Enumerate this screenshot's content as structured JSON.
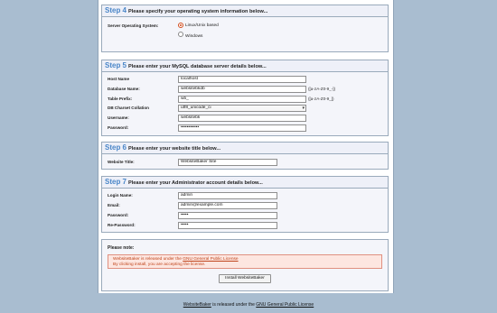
{
  "step4": {
    "number": "Step 4",
    "title": "Please specify your operating system information below...",
    "os_label": "Server Operating System:",
    "options": [
      {
        "label": "Linux/Unix based",
        "selected": true
      },
      {
        "label": "Windows",
        "selected": false
      }
    ]
  },
  "step5": {
    "number": "Step 5",
    "title": "Please enter your MySQL database server details below...",
    "fields": [
      {
        "label": "Host Name",
        "value": "localhost",
        "hint": ""
      },
      {
        "label": "Database Name:",
        "value": "websitebkdb",
        "hint": "([a-zA-Z0-9_-])"
      },
      {
        "label": "Table Prefix:",
        "value": "wb_",
        "hint": "([a-zA-Z0-9_])"
      },
      {
        "label": "DB Charset Collation",
        "value": "utf8_unicode_ci",
        "hint": ""
      },
      {
        "label": "Username:",
        "value": "websitebk",
        "hint": ""
      },
      {
        "label": "Password:",
        "value": "••••••••••••",
        "hint": ""
      }
    ]
  },
  "step6": {
    "number": "Step 6",
    "title": "Please enter your website title below...",
    "label": "Website Title:",
    "value": "WebsiteBaker Site"
  },
  "step7": {
    "number": "Step 7",
    "title": "Please enter your Administrator account details below...",
    "fields": [
      {
        "label": "Login Name:",
        "value": "admin"
      },
      {
        "label": "Email:",
        "value": "admin@example.com"
      },
      {
        "label": "Password:",
        "value": "•••••"
      },
      {
        "label": "Re-Password:",
        "value": "•••••"
      }
    ]
  },
  "note": {
    "title": "Please note:",
    "line1_prefix": "WebsiteBaker is released under the ",
    "line1_link": "GNU General Public License",
    "line2": "By clicking install, you are accepting the license.",
    "install_label": "Install WebsiteBaker"
  },
  "footer": {
    "link1": "WebsiteBaker",
    "text": " is released under the ",
    "link2": "GNU General Public License"
  },
  "colors": {
    "background": "#a9bdd0",
    "step_number": "#4a86c8",
    "notice_text": "#c0451c",
    "notice_bg": "#fde6e0"
  }
}
